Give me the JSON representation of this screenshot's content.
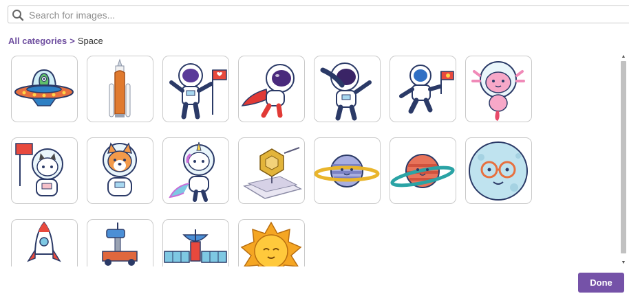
{
  "search": {
    "placeholder": "Search for images..."
  },
  "breadcrumb": {
    "root": "All categories",
    "separator": ">",
    "current": "Space"
  },
  "images": [
    {
      "name": "ufo-alien"
    },
    {
      "name": "rocket-launch"
    },
    {
      "name": "astronaut-flag"
    },
    {
      "name": "flying-astronaut-cape"
    },
    {
      "name": "dabbing-astronaut"
    },
    {
      "name": "floating-astronaut-flag"
    },
    {
      "name": "axolotl-astronaut"
    },
    {
      "name": "cat-astronaut-flag"
    },
    {
      "name": "corgi-astronaut"
    },
    {
      "name": "unicorn-astronaut"
    },
    {
      "name": "space-telescope"
    },
    {
      "name": "saturn-purple"
    },
    {
      "name": "planet-orange-ring"
    },
    {
      "name": "moon-glasses"
    },
    {
      "name": "rocket"
    },
    {
      "name": "robot-rover"
    },
    {
      "name": "satellite"
    },
    {
      "name": "sun"
    }
  ],
  "colors": {
    "accent": "#7552a8",
    "breadcrumb": "#6f4fa0"
  },
  "footer": {
    "done_label": "Done"
  }
}
